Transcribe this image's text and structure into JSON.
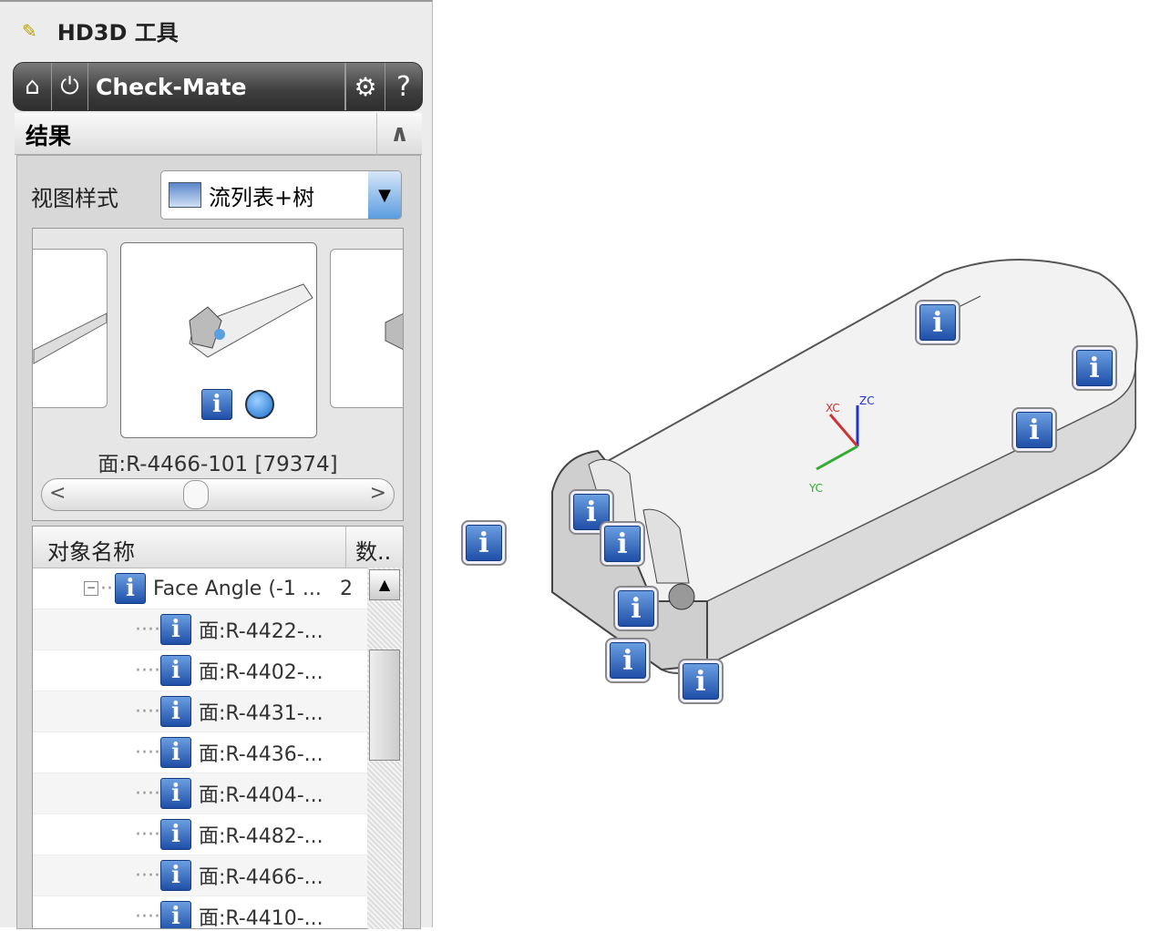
{
  "panel": {
    "title": "HD3D 工具",
    "tool_name": "Check-Mate",
    "results_label": "结果",
    "view_style_label": "视图样式",
    "view_style_value": "流列表+树",
    "caption": "面:R-4466-101 [79374]"
  },
  "table": {
    "columns": [
      "对象名称",
      "数.."
    ],
    "parent": {
      "label": "Face Angle (-1 ...",
      "count": "2"
    },
    "children": [
      "面:R-4422-...",
      "面:R-4402-...",
      "面:R-4431-...",
      "面:R-4436-...",
      "面:R-4404-...",
      "面:R-4482-...",
      "面:R-4466-...",
      "面:R-4410-..."
    ]
  },
  "axes": {
    "x": "XC",
    "y": "YC",
    "z": "ZC"
  },
  "colors": {
    "accent": "#1f4fa8",
    "toolbar": "#3e3e3e"
  }
}
